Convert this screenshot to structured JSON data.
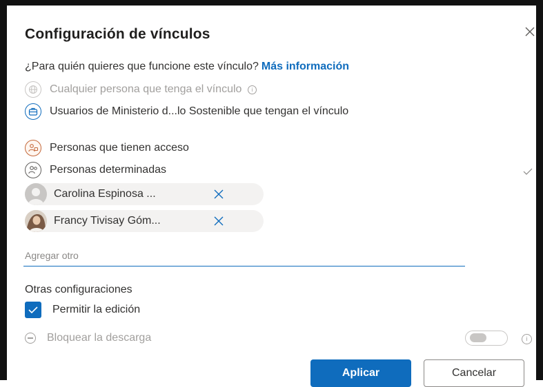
{
  "dialog": {
    "title": "Configuración de vínculos",
    "question": "¿Para quién quieres que funcione este vínculo?",
    "more_info_link": "Más información"
  },
  "options": [
    {
      "label": "Cualquier persona que tenga el vínculo",
      "icon": "globe-icon",
      "disabled": true,
      "has_info": true
    },
    {
      "label": "Usuarios de Ministerio d...lo Sostenible que tengan el vínculo",
      "icon": "organization-icon",
      "disabled": false
    },
    {
      "label": "Personas que tienen acceso",
      "icon": "people-access-icon",
      "disabled": false
    },
    {
      "label": "Personas determinadas",
      "icon": "specific-people-icon",
      "disabled": false,
      "selected": true
    }
  ],
  "recipients": [
    {
      "name": "Carolina Espinosa ...",
      "avatar": "default-person-avatar"
    },
    {
      "name": "Francy Tivisay Góm...",
      "avatar": "photo-avatar"
    }
  ],
  "add_input": {
    "placeholder": "Agregar otro",
    "value": ""
  },
  "other_settings": {
    "title": "Otras configuraciones",
    "allow_edit_label": "Permitir la edición",
    "allow_edit_checked": true,
    "block_download_label": "Bloquear la descarga",
    "block_download_on": false
  },
  "buttons": {
    "apply": "Aplicar",
    "cancel": "Cancelar"
  },
  "colors": {
    "accent": "#0f6cbd",
    "disabled": "#a19f9d"
  }
}
